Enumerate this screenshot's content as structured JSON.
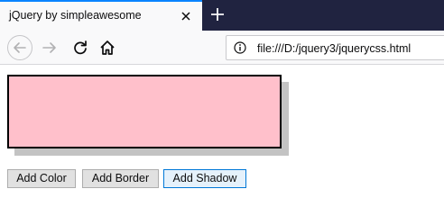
{
  "browser": {
    "tab_title": "jQuery by simpleawesome",
    "url": "file:///D:/jquery3/jquerycss.html"
  },
  "page": {
    "buttons": {
      "add_color": "Add Color",
      "add_border": "Add Border",
      "add_shadow": "Add Shadow"
    },
    "box_color": "#ffc0cb",
    "box_border_color": "#000000",
    "box_shadow_color": "#c3c3c3"
  },
  "icons": [
    "close-icon",
    "plus-icon",
    "back-arrow-icon",
    "forward-arrow-icon",
    "reload-icon",
    "home-icon",
    "info-icon"
  ],
  "colors": {
    "tabstrip": "#202340",
    "tab_accent": "#0a84ff",
    "toolbar": "#f9f9fa"
  }
}
